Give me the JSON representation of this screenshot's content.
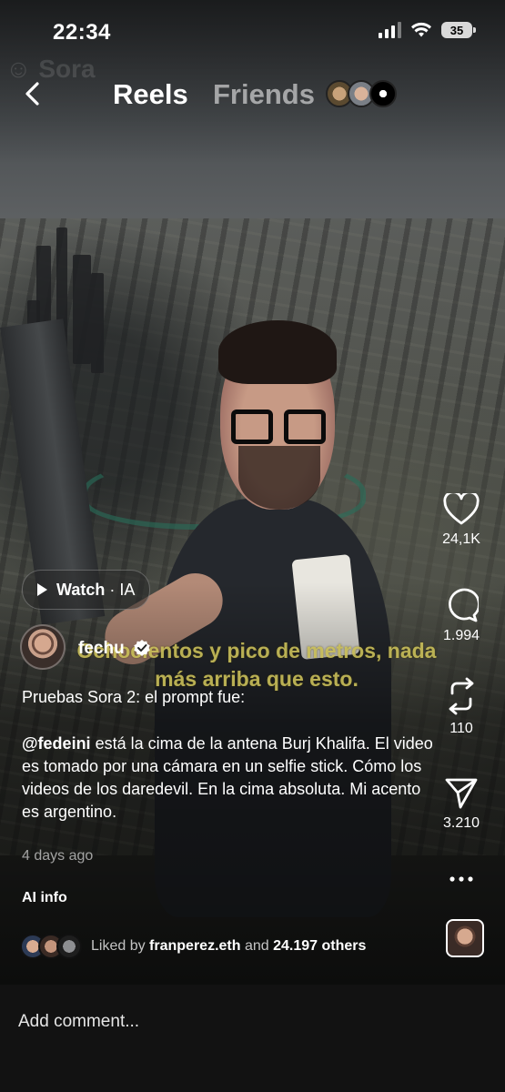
{
  "status_bar": {
    "time": "22:34",
    "battery": "35"
  },
  "nav": {
    "back_icon": "chevron-left-icon",
    "tabs": [
      {
        "label": "Reels",
        "active": true
      },
      {
        "label": "Friends",
        "active": false
      }
    ]
  },
  "video": {
    "subtitle": "Ochocientos y pico de metros, nada más arriba que esto."
  },
  "actions": {
    "like": {
      "icon": "heart-icon",
      "count": "24,1K"
    },
    "comment": {
      "icon": "comment-icon",
      "count": "1.994"
    },
    "repost": {
      "icon": "repost-icon",
      "count": "110"
    },
    "share": {
      "icon": "send-icon",
      "count": "3.210"
    },
    "more": {
      "icon": "more-icon"
    }
  },
  "watch_pill": {
    "label": "Watch",
    "separator": " · ",
    "tag": "IA"
  },
  "post": {
    "author": "fechu",
    "caption_line1": "Pruebas Sora 2: el prompt fue:",
    "caption_mention": "@fedeini",
    "caption_rest": " está la cima de la antena Burj Khalifa. El video es tomado por una cámara en un selfie stick. Cómo los videos de los daredevil. En la cima absoluta. Mi acento es argentino.",
    "age": "4 days ago",
    "ai_info": "AI info"
  },
  "likes": {
    "prefix": "Liked by ",
    "user": "franperez.eth",
    "middle": " and ",
    "others": "24.197 others"
  },
  "comment": {
    "placeholder": "Add comment..."
  },
  "colors": {
    "subtitle": "#d2c85f",
    "comment_bar": "#121212"
  }
}
